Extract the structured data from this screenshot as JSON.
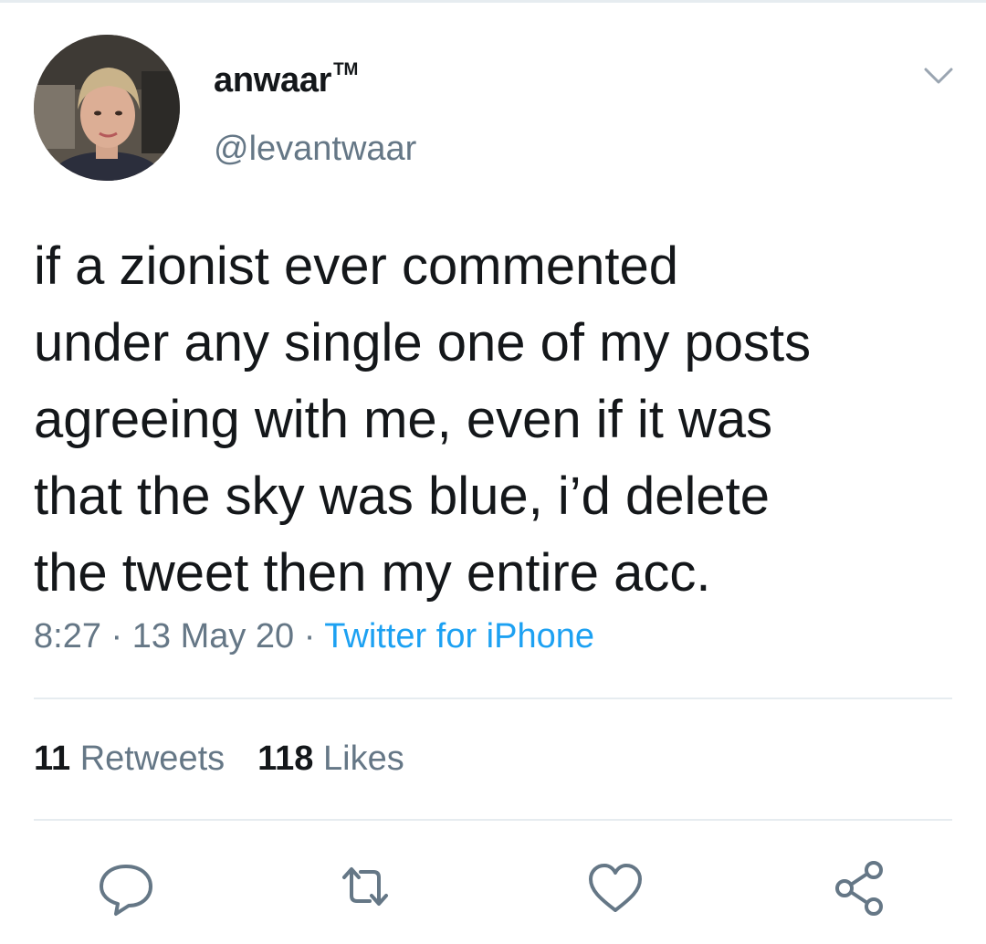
{
  "tweet": {
    "author": {
      "display_name": "anwaar",
      "trademark": "TM",
      "handle": "@levantwaar",
      "avatar_icon": "profile-photo"
    },
    "text_lines": [
      "if a zionist ever commented",
      "under any single one of my posts",
      "agreeing with me, even if it was",
      "that the sky was blue, i’d delete",
      "the tweet then my entire acc."
    ],
    "time": "8:27",
    "separator": "·",
    "date": "13 May 20",
    "source": "Twitter for iPhone",
    "stats": {
      "retweets_count": "11",
      "retweets_label": "Retweets",
      "likes_count": "118",
      "likes_label": "Likes"
    },
    "actions": [
      {
        "icon": "reply-icon"
      },
      {
        "icon": "retweet-icon"
      },
      {
        "icon": "like-icon"
      },
      {
        "icon": "share-icon"
      }
    ]
  },
  "colors": {
    "text_primary": "#14171a",
    "text_secondary": "#657786",
    "link": "#1da1f2",
    "divider": "#e6ecf0"
  }
}
